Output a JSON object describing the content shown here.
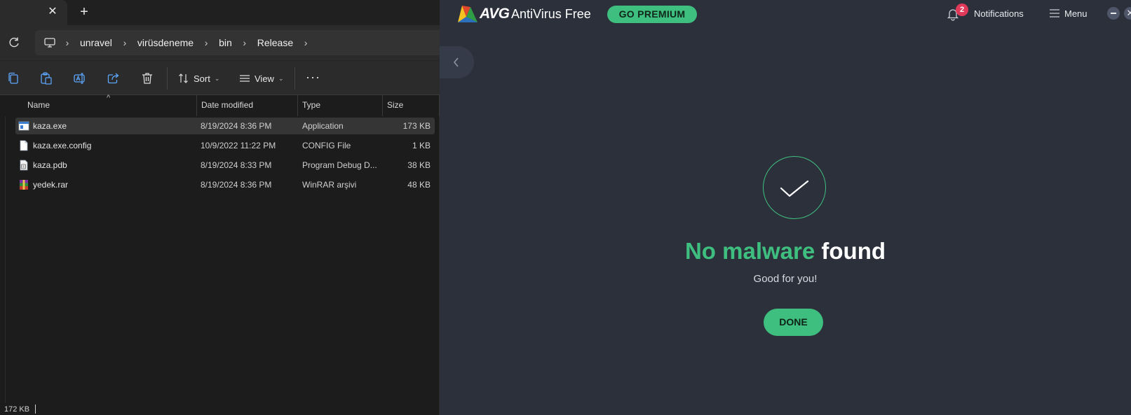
{
  "explorer": {
    "tab": {
      "close_glyph": "✕"
    },
    "new_tab_glyph": "+",
    "breadcrumb": [
      "unravel",
      "virüsdeneme",
      "bin",
      "Release"
    ],
    "toolbar": {
      "sort_label": "Sort",
      "view_label": "View",
      "more_label": "···"
    },
    "columns": {
      "name": "Name",
      "date": "Date modified",
      "type": "Type",
      "size": "Size"
    },
    "files": [
      {
        "name": "kaza.exe",
        "date": "8/19/2024 8:36 PM",
        "type": "Application",
        "size": "173 KB",
        "icon": "application-icon",
        "selected": true
      },
      {
        "name": "kaza.exe.config",
        "date": "10/9/2022 11:22 PM",
        "type": "CONFIG File",
        "size": "1 KB",
        "icon": "document-icon",
        "selected": false
      },
      {
        "name": "kaza.pdb",
        "date": "8/19/2024 8:33 PM",
        "type": "Program Debug D...",
        "size": "38 KB",
        "icon": "debug-file-icon",
        "selected": false
      },
      {
        "name": "yedek.rar",
        "date": "8/19/2024 8:36 PM",
        "type": "WinRAR arşivi",
        "size": "48 KB",
        "icon": "winrar-archive-icon",
        "selected": false
      }
    ],
    "status": "172 KB"
  },
  "avg": {
    "brand": "AVG",
    "product": "AntiVirus Free",
    "premium_button": "GO PREMIUM",
    "notifications_count": "2",
    "notifications_label": "Notifications",
    "menu_label": "Menu",
    "close_glyph": "✕",
    "result": {
      "headline_green": "No malware",
      "headline_white": "found",
      "subtext": "Good for you!"
    },
    "done_button": "DONE",
    "colors": {
      "accent": "#3fbf7f",
      "background": "#2b303b",
      "badge": "#e0395a"
    }
  }
}
